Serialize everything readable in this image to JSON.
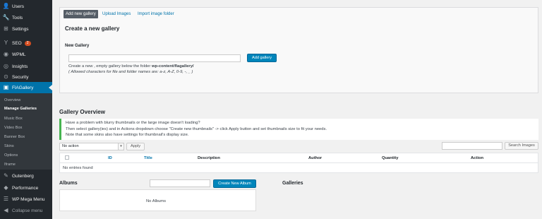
{
  "sidebar": {
    "items": [
      {
        "label": "Users",
        "icon": "users-icon",
        "glyph": "👤"
      },
      {
        "label": "Tools",
        "icon": "tools-icon",
        "glyph": "🔧"
      },
      {
        "label": "Settings",
        "icon": "settings-icon",
        "glyph": "⊞"
      },
      {
        "label": "SEO",
        "icon": "seo-icon",
        "glyph": "Y",
        "badge": "2"
      },
      {
        "label": "WPML",
        "icon": "wpml-icon",
        "glyph": "◉"
      },
      {
        "label": "Insights",
        "icon": "insights-icon",
        "glyph": "◎"
      },
      {
        "label": "Security",
        "icon": "security-icon",
        "glyph": "⊙"
      },
      {
        "label": "FlAGallery",
        "icon": "flagallery-icon",
        "glyph": "▣"
      },
      {
        "label": "Gutenberg",
        "icon": "gutenberg-icon",
        "glyph": "✎"
      },
      {
        "label": "Performance",
        "icon": "performance-icon",
        "glyph": "◆"
      },
      {
        "label": "WP Mega Menu",
        "icon": "megamenu-icon",
        "glyph": "☰"
      },
      {
        "label": "Collapse menu",
        "icon": "collapse-icon",
        "glyph": "◀"
      }
    ],
    "submenu": [
      "Overview",
      "Manage Galleries",
      "Music Box",
      "Video Box",
      "Banner Box",
      "Skins",
      "Options",
      "Iframe"
    ]
  },
  "tabs": [
    "Add new gallery",
    "Upload Images",
    "Import image folder"
  ],
  "create": {
    "title": "Create a new gallery",
    "field_label": "New Gallery",
    "input_value": "",
    "button": "Add gallery",
    "help_prefix": "Create a new , empty gallery below the folder ",
    "help_folder": "wp-content/flagallery/",
    "help_chars": "( Allowed characters for file and folder names are: a-z, A-Z, 0-9, -, _ )"
  },
  "overview": {
    "title": "Gallery Overview",
    "notice": [
      "Have a problem with blurry thumbnails or the large image doesn't loading?",
      "Then select gallery(ies) and in Actions dropdown choose \"Create new thumbnails\" -> click Apply button and set thumbnails size to fit your needs.",
      "Note that some skins also have settings for thumbnail's display size."
    ],
    "bulk_select": "No action",
    "apply": "Apply",
    "search_value": "",
    "search_button": "Search Images",
    "columns": [
      "ID",
      "Title",
      "Description",
      "Author",
      "Quantity",
      "Action"
    ],
    "empty": "No entries found"
  },
  "albums": {
    "title": "Albums",
    "input_value": "",
    "button": "Create New Album",
    "empty": "No Albums"
  },
  "galleries": {
    "title": "Galleries"
  }
}
